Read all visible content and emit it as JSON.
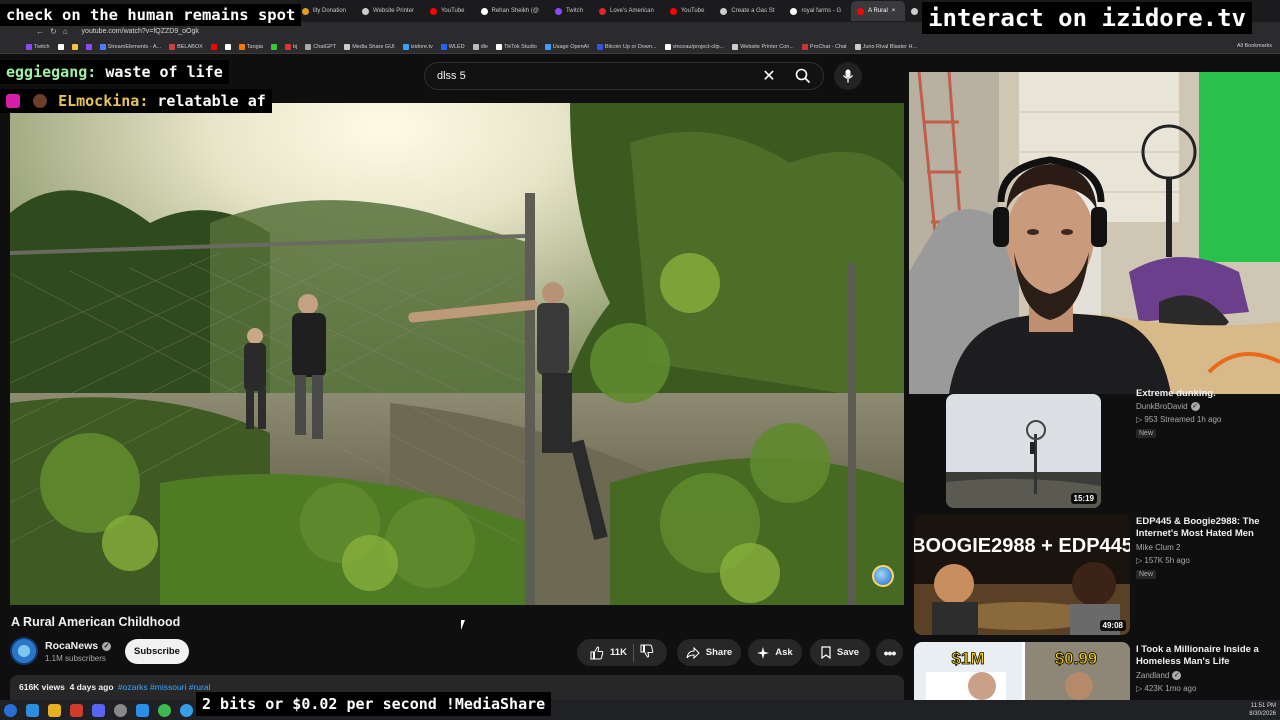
{
  "overlays": {
    "top_left": "check on the human remains spot",
    "top_right": "interact on izidore.tv",
    "bottom": "2 bits or $0.02 per second !MediaShare",
    "chat": [
      {
        "user": "eggiegang:",
        "message": "waste of life"
      },
      {
        "user": "ELmockina:",
        "message": "relatable af"
      }
    ]
  },
  "browser": {
    "tabs": [
      {
        "label": "lity Donation",
        "color": "#e0a020"
      },
      {
        "label": "Website Printer",
        "color": "#cccccc"
      },
      {
        "label": "YouTube",
        "color": "#ff0000"
      },
      {
        "label": "Rehan Sheikh (@",
        "color": "#ffffff"
      },
      {
        "label": "Twitch",
        "color": "#9146ff"
      },
      {
        "label": "Love's American",
        "color": "#e0282a"
      },
      {
        "label": "YouTube",
        "color": "#ff0000"
      },
      {
        "label": "Create a Gas St",
        "color": "#cccccc"
      },
      {
        "label": "royal farms - G",
        "color": "#ffffff"
      },
      {
        "label": "A Rural",
        "color": "#ff0000",
        "active": true
      },
      {
        "label": "Rally",
        "color": "#cccccc"
      }
    ],
    "url": "youtube.com/watch?v=fQZZD9_oOgk",
    "bookmarks": [
      {
        "label": "Twitch",
        "color": "#9146ff"
      },
      {
        "label": "",
        "color": "#ffffff"
      },
      {
        "label": "",
        "color": "#f5c542"
      },
      {
        "label": "",
        "color": "#9146ff"
      },
      {
        "label": "StreamElements - A...",
        "color": "#4f7cff"
      },
      {
        "label": "BELABOX",
        "color": "#d04040"
      },
      {
        "label": "",
        "color": "#ff0000"
      },
      {
        "label": "",
        "color": "#ffffff"
      },
      {
        "label": "Tangia",
        "color": "#ff7a00"
      },
      {
        "label": "",
        "color": "#33cc33"
      },
      {
        "label": "bj",
        "color": "#e03333"
      },
      {
        "label": "ChatGPT",
        "color": "#aaaaaa"
      },
      {
        "label": "Media Share GUI",
        "color": "#cccccc"
      },
      {
        "label": "izidore.tv",
        "color": "#3aa0ff"
      },
      {
        "label": "WLED",
        "color": "#2266ff"
      },
      {
        "label": "dle",
        "color": "#bbbbbb"
      },
      {
        "label": "TikTok Studio",
        "color": "#ffffff"
      },
      {
        "label": "Usage OpenAI",
        "color": "#3aa0ff"
      },
      {
        "label": "Bitcoin Up or Down...",
        "color": "#3355dd"
      },
      {
        "label": "vinceau/project-clip...",
        "color": "#ffffff"
      },
      {
        "label": "Website Printer Con...",
        "color": "#cccccc"
      },
      {
        "label": "ProChat - Chat",
        "color": "#cc3333"
      },
      {
        "label": "Juno Rival Blaster H...",
        "color": "#cccccc"
      }
    ],
    "all_bookmarks": "All Bookmarks"
  },
  "search": {
    "query": "dlss 5"
  },
  "video": {
    "title": "A Rural American Childhood",
    "channel": "RocaNews",
    "subscribers": "1.1M subscribers",
    "subscribe_label": "Subscribe",
    "likes": "11K",
    "share_label": "Share",
    "ask_label": "Ask",
    "save_label": "Save",
    "views": "616K views",
    "age": "4 days ago",
    "tags": "#ozarks #missouri #rural"
  },
  "recommendations": [
    {
      "title": "Extreme dunking.",
      "channel": "DunkBroDavid",
      "stats": "953  Streamed 1h ago",
      "badge": "New",
      "duration": "15:19"
    },
    {
      "title": "EDP445 & Boogie2988: The Internet's Most Hated Men",
      "channel": "Mike Clum 2",
      "stats": "157K  5h ago",
      "badge": "New",
      "duration": "49:08",
      "thumb_text": "BOOGIE2988 + EDP445"
    },
    {
      "title": "I Took a Millionaire Inside a Homeless Man's Life",
      "channel": "Zandland",
      "stats": "423K  1mo ago",
      "thumb_left": "$1M",
      "thumb_right": "$0.99"
    }
  ],
  "taskbar": {
    "time": "11:51 PM",
    "date": "8/30/2026"
  }
}
